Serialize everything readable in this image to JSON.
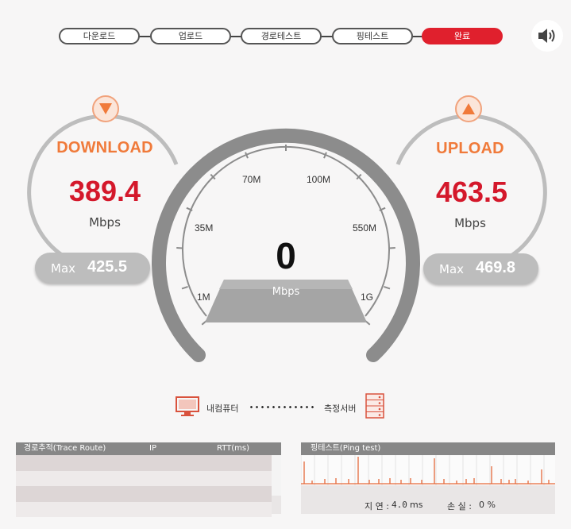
{
  "steps": [
    "다운로드",
    "업로드",
    "경로테스트",
    "핑테스트",
    "완료"
  ],
  "active_step": "완료",
  "sound_icon": "speaker-icon",
  "download": {
    "title": "DOWNLOAD",
    "value": "389.4",
    "unit": "Mbps",
    "max_label": "Max",
    "max_value": "425.5"
  },
  "upload": {
    "title": "UPLOAD",
    "value": "463.5",
    "unit": "Mbps",
    "max_label": "Max",
    "max_value": "469.8"
  },
  "gauge": {
    "value": "0",
    "unit": "Mbps",
    "scale_labels": [
      "1M",
      "35M",
      "70M",
      "100M",
      "550M",
      "1G"
    ]
  },
  "connection": {
    "left_label": "내컴퓨터",
    "right_label": "측정서버"
  },
  "trace": {
    "header": "경로추적(Trace Route)",
    "col_ip": "IP",
    "col_rtt": "RTT(ms)"
  },
  "ping": {
    "header": "핑테스트(Ping test)",
    "latency_label": "지 연 :",
    "latency_value": "4.0",
    "latency_unit": "ms",
    "loss_label": "손 실 :",
    "loss_value": "0 %"
  },
  "colors": {
    "accent_red": "#d4182b",
    "accent_orange": "#f07a3a",
    "active_step": "#e0202d",
    "gauge_gray": "#8c8c8c"
  }
}
